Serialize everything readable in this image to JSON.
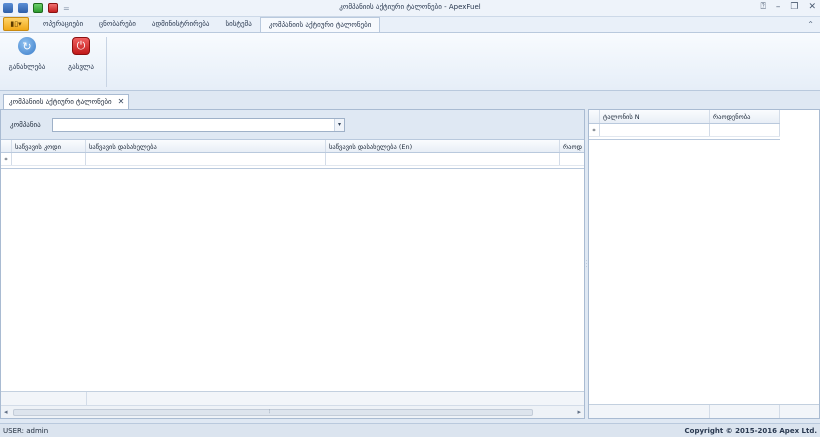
{
  "titlebar": {
    "title": "კომპანიის აქტიური ტალონები - ApexFuel",
    "quick_access": [
      "app-icon",
      "save-icon",
      "green-icon",
      "red-icon",
      "customize-icon"
    ],
    "window_controls": [
      "help-icon",
      "minimize-icon",
      "restore-icon",
      "close-icon"
    ]
  },
  "ribbon": {
    "app_button_label": "▾",
    "tabs": [
      {
        "label": "ოპერაციები"
      },
      {
        "label": "ცნობარები"
      },
      {
        "label": "ადმინისტრირება"
      },
      {
        "label": "სისტემა"
      },
      {
        "label": "კომპანიის აქტიური ტალონები"
      }
    ],
    "active_tab": 4,
    "buttons": [
      {
        "label": "განახლება",
        "icon": "refresh-icon"
      },
      {
        "label": "გასვლა",
        "icon": "power-icon"
      }
    ]
  },
  "document_tab": {
    "label": "კომპანიის აქტიური ტალონები",
    "close": "✕"
  },
  "filter": {
    "label": "კომპანია",
    "value": ""
  },
  "main_grid": {
    "columns": [
      "საწვავის კოდი",
      "საწვავის დასახელება",
      "საწვავის დასახელება (En)",
      "რაოდ"
    ],
    "new_row_indicator": "*"
  },
  "side_grid": {
    "columns": [
      "ტალონის N",
      "რაოდენობა"
    ],
    "new_row_indicator": "*"
  },
  "status": {
    "user": "USER: admin",
    "copyright": "Copyright © 2015-2016 Apex Ltd."
  }
}
